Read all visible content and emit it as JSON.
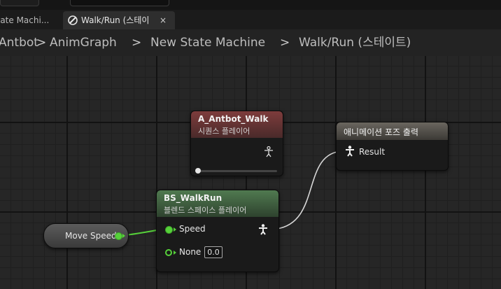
{
  "tabs": [
    {
      "label": "State Machi..."
    },
    {
      "label": "Walk/Run (스테이",
      "close": "×"
    }
  ],
  "breadcrumb": [
    "Antbot",
    "AnimGraph",
    "New State Machine",
    "Walk/Run (스테이트)"
  ],
  "breadcrumb_separator": ">",
  "nodes": {
    "sequence_player": {
      "title": "A_Antbot_Walk",
      "subtitle": "시퀀스 플레이어",
      "header_color": "#7e3c3c"
    },
    "blendspace_player": {
      "title": "BS_WalkRun",
      "subtitle": "블렌드 스페이스 플레이어",
      "header_color": "#507a50",
      "pins": {
        "speed": "Speed",
        "none": "None",
        "none_value": "0.0"
      }
    },
    "output_pose": {
      "title": "애니메이션 포즈 출력",
      "result": "Result",
      "header_color": "#6a665f"
    },
    "variable": {
      "label": "Move Speed"
    }
  },
  "colors": {
    "float_pin": "#56d13a",
    "pose_wire": "#d8d8d8",
    "background": "#262626"
  }
}
